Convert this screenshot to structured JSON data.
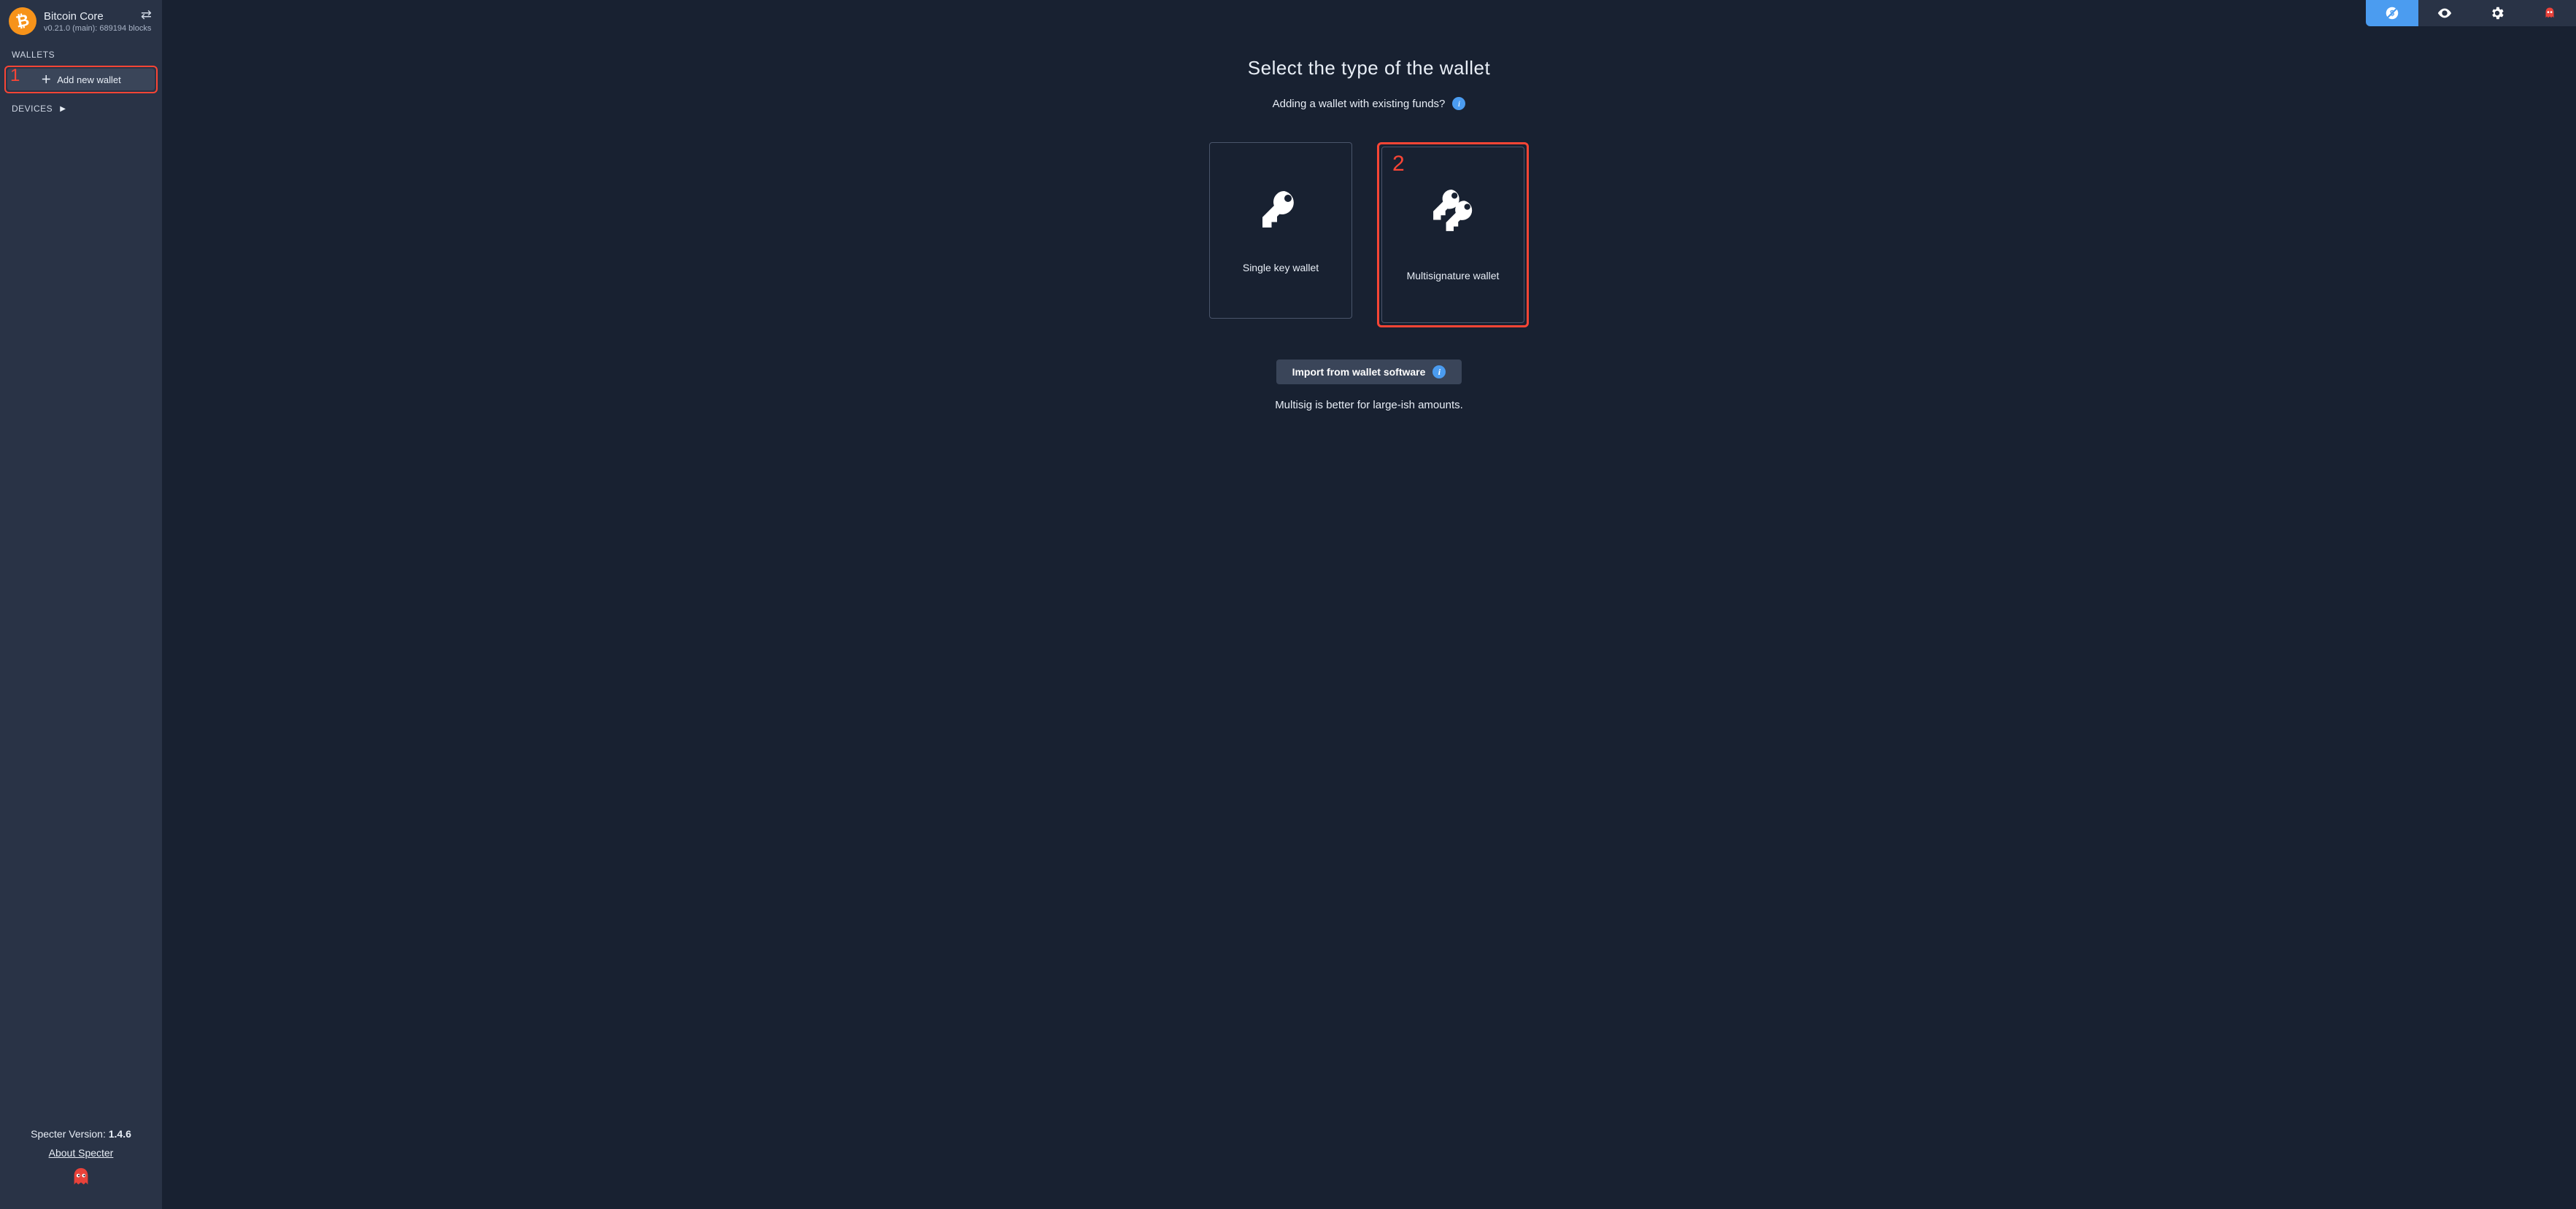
{
  "sidebar": {
    "node": {
      "title": "Bitcoin Core",
      "subtitle": "v0.21.0 (main): 689194 blocks"
    },
    "wallets_label": "WALLETS",
    "add_wallet_label": "Add new wallet",
    "devices_label": "DEVICES",
    "version_prefix": "Specter Version: ",
    "version_number": "1.4.6",
    "about_label": "About Specter"
  },
  "topbar": {
    "items": [
      {
        "name": "price-toggle",
        "active": true
      },
      {
        "name": "privacy-eye",
        "active": false
      },
      {
        "name": "settings-gear",
        "active": false
      },
      {
        "name": "tor-ghost",
        "active": false
      }
    ]
  },
  "main": {
    "title": "Select the type of the wallet",
    "subline": "Adding a wallet with existing funds?",
    "cards": {
      "single": "Single key wallet",
      "multisig": "Multisignature wallet"
    },
    "import_label": "Import from wallet software",
    "hint": "Multisig is better for large-ish amounts."
  },
  "annotations": {
    "one": "1",
    "two": "2"
  },
  "colors": {
    "accent": "#4b9cf0",
    "annotation": "#fa4535",
    "panel": "#293346",
    "bg": "#182131"
  }
}
